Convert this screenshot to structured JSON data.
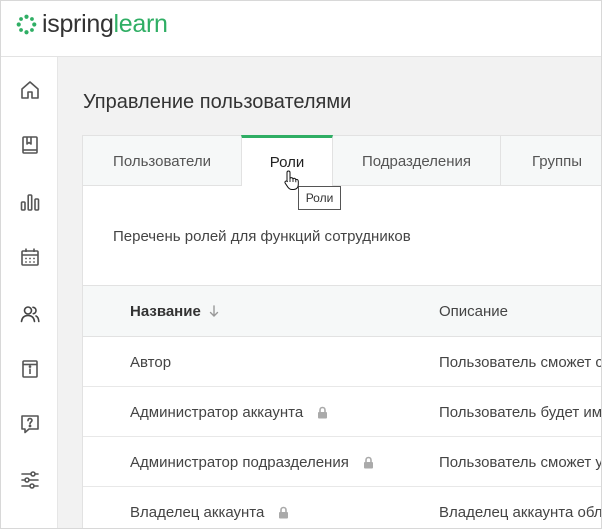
{
  "brand": {
    "part1": "ispring",
    "part2": "learn",
    "accent": "#2fae64"
  },
  "sidebar": {
    "items": [
      {
        "icon": "home-icon"
      },
      {
        "icon": "book-icon"
      },
      {
        "icon": "bar-chart-icon"
      },
      {
        "icon": "calendar-icon"
      },
      {
        "icon": "users-icon"
      },
      {
        "icon": "info-card-icon"
      },
      {
        "icon": "help-icon"
      },
      {
        "icon": "sliders-icon"
      }
    ]
  },
  "page": {
    "title": "Управление пользователями"
  },
  "tabs": [
    {
      "label": "Пользователи",
      "active": false
    },
    {
      "label": "Роли",
      "active": true
    },
    {
      "label": "Подразделения",
      "active": false
    },
    {
      "label": "Группы",
      "active": false
    }
  ],
  "tooltip": {
    "text": "Роли"
  },
  "roles": {
    "description": "Перечень ролей для функций сотрудников",
    "columns": {
      "name": "Название",
      "description": "Описание"
    },
    "rows": [
      {
        "name": "Автор",
        "locked": false,
        "description": "Пользователь сможет создавать и"
      },
      {
        "name": "Администратор аккаунта",
        "locked": true,
        "description": "Пользователь будет иметь доступ"
      },
      {
        "name": "Администратор подразделения",
        "locked": true,
        "description": "Пользователь сможет управлять"
      },
      {
        "name": "Владелец аккаунта",
        "locked": true,
        "description": "Владелец аккаунта обладает"
      }
    ]
  }
}
